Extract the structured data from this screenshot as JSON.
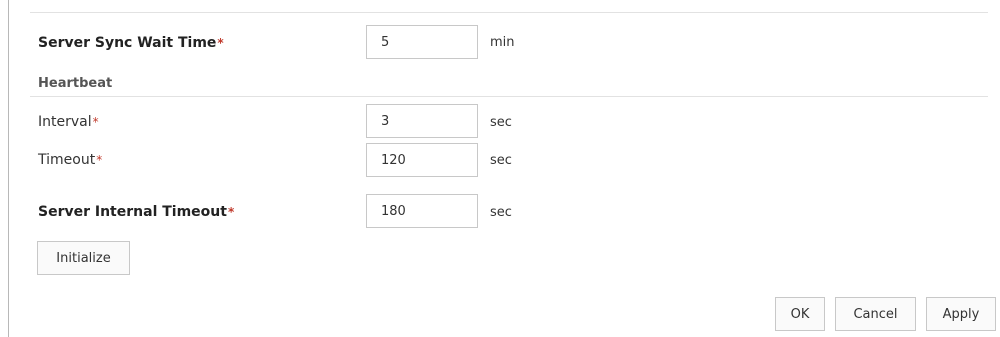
{
  "settings": {
    "server_sync_wait_time": {
      "label": "Server Sync Wait Time",
      "required_mark": "*",
      "value": "5",
      "unit": "min"
    },
    "heartbeat": {
      "heading": "Heartbeat",
      "interval": {
        "label": "Interval",
        "required_mark": "*",
        "value": "3",
        "unit": "sec"
      },
      "timeout": {
        "label": "Timeout",
        "required_mark": "*",
        "value": "120",
        "unit": "sec"
      }
    },
    "server_internal_timeout": {
      "label": "Server Internal Timeout",
      "required_mark": "*",
      "value": "180",
      "unit": "sec"
    }
  },
  "buttons": {
    "initialize": "Initialize",
    "ok": "OK",
    "cancel": "Cancel",
    "apply": "Apply"
  },
  "colors": {
    "required_mark": "#c0392b",
    "border": "#c8c8c8"
  }
}
